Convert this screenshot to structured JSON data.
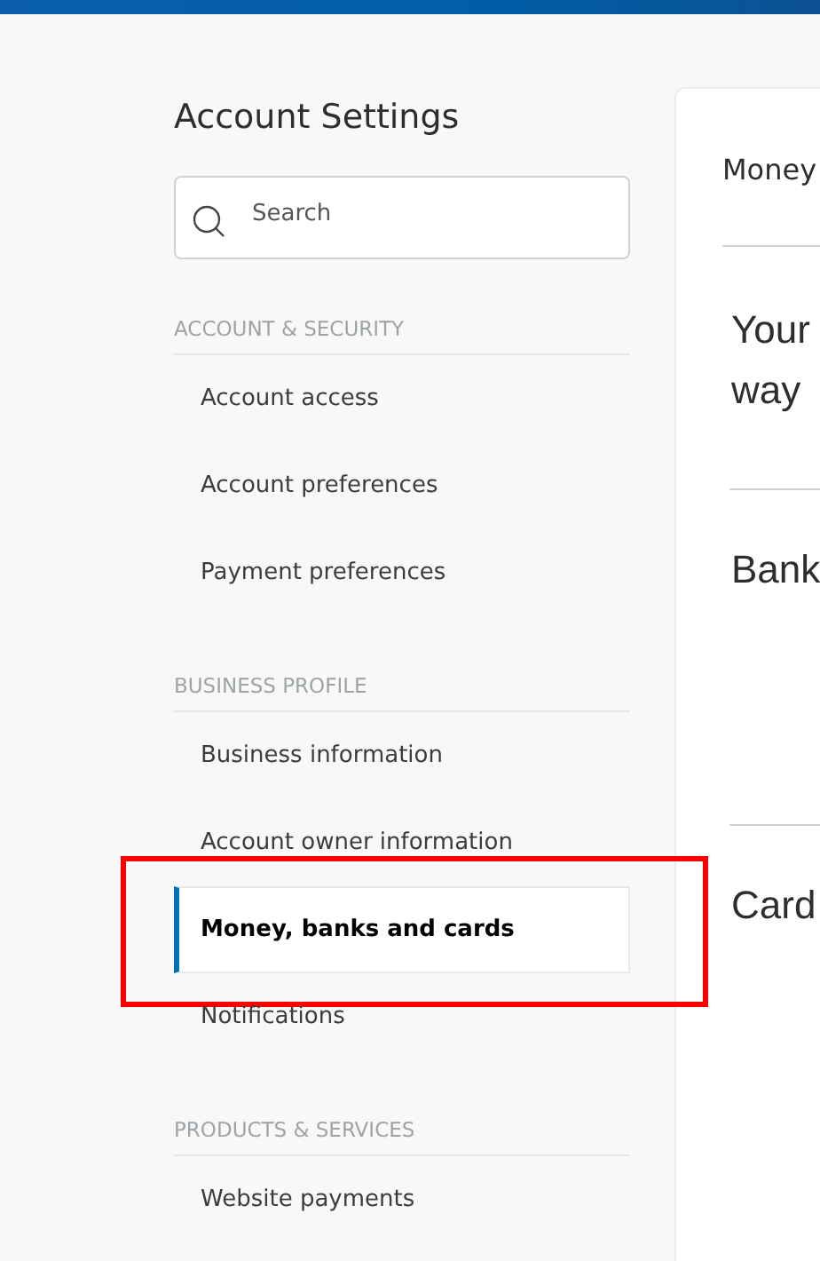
{
  "sidebar": {
    "title": "Account Settings",
    "search": {
      "placeholder": "Search"
    },
    "sections": [
      {
        "heading": "ACCOUNT & SECURITY",
        "items": [
          {
            "label": "Account access",
            "selected": false,
            "highlighted": false
          },
          {
            "label": "Account preferences",
            "selected": false,
            "highlighted": false
          },
          {
            "label": "Payment preferences",
            "selected": false,
            "highlighted": false
          }
        ]
      },
      {
        "heading": "BUSINESS PROFILE",
        "items": [
          {
            "label": "Business information",
            "selected": false,
            "highlighted": false
          },
          {
            "label": "Account owner information",
            "selected": false,
            "highlighted": false
          },
          {
            "label": "Money, banks and cards",
            "selected": true,
            "highlighted": true
          },
          {
            "label": "Notifications",
            "selected": false,
            "highlighted": false
          }
        ]
      },
      {
        "heading": "PRODUCTS & SERVICES",
        "items": [
          {
            "label": "Website payments",
            "selected": false,
            "highlighted": false
          }
        ]
      }
    ]
  },
  "panel": {
    "title": "Money",
    "intro": [
      "Your",
      "way"
    ],
    "sections": [
      "Bank",
      "Card"
    ]
  }
}
